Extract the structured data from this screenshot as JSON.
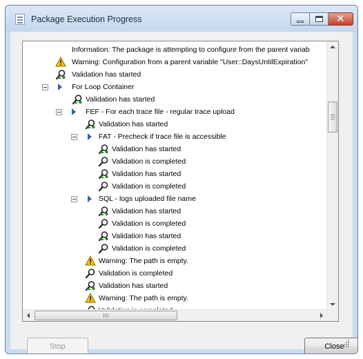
{
  "window": {
    "title": "Package Execution Progress",
    "icon": "package-document-icon"
  },
  "buttons": {
    "stop_label": "Stop",
    "stop_enabled": false,
    "close_label": "Close"
  },
  "scrollbars": {
    "horizontal_grip": "III"
  },
  "colors": {
    "arrow": "#2e64b8",
    "warning": "#f5c400",
    "validation_started_icon": "#2f8a2f"
  },
  "tree": [
    {
      "text": "Information: The package is attempting to configure from the parent variab",
      "icon": "none"
    },
    {
      "text": "Warning: Configuration from a parent variable \"User::DaysUntilExpiration\"",
      "icon": "warning-icon"
    },
    {
      "text": "Validation has started",
      "icon": "validation-started-icon"
    },
    {
      "text": "For Loop Container",
      "icon": "container-arrow-icon",
      "expanded": true
    },
    {
      "text": "Validation has started",
      "icon": "validation-started-icon"
    },
    {
      "text": "FEF - For each trace file - regular trace upload",
      "icon": "container-arrow-icon",
      "expanded": true
    },
    {
      "text": "Validation has started",
      "icon": "validation-started-icon"
    },
    {
      "text": "FAT - Precheck if trace file is accessible",
      "icon": "container-arrow-icon",
      "expanded": true
    },
    {
      "text": "Validation has started",
      "icon": "validation-started-icon"
    },
    {
      "text": "Validation is completed",
      "icon": "validation-completed-icon"
    },
    {
      "text": "Validation has started",
      "icon": "validation-started-icon"
    },
    {
      "text": "Validation is completed",
      "icon": "validation-completed-icon"
    },
    {
      "text": "SQL - logs uploaded file name",
      "icon": "container-arrow-icon",
      "expanded": true
    },
    {
      "text": "Validation has started",
      "icon": "validation-started-icon"
    },
    {
      "text": "Validation is completed",
      "icon": "validation-completed-icon"
    },
    {
      "text": "Validation has started",
      "icon": "validation-started-icon"
    },
    {
      "text": "Validation is completed",
      "icon": "validation-completed-icon"
    },
    {
      "text": "Warning: The path is empty.",
      "icon": "warning-icon"
    },
    {
      "text": "Validation is completed",
      "icon": "validation-completed-icon"
    },
    {
      "text": "Validation has started",
      "icon": "validation-started-icon"
    },
    {
      "text": "Warning: The path is empty.",
      "icon": "warning-icon"
    },
    {
      "text": "Validation is completed",
      "icon": "validation-completed-icon"
    }
  ]
}
